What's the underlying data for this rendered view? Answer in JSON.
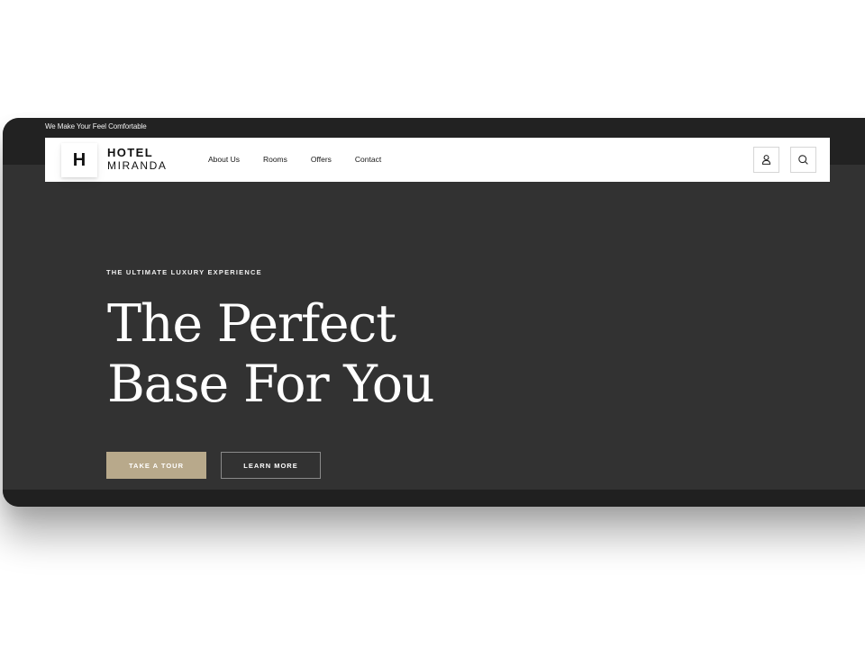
{
  "topbar": {
    "tagline": "We Make Your Feel Comfortable"
  },
  "header": {
    "logo_initial": "H",
    "brand_line1": "HOTEL",
    "brand_line2": "MIRANDA",
    "nav": [
      {
        "label": "About Us"
      },
      {
        "label": "Rooms"
      },
      {
        "label": "Offers"
      },
      {
        "label": "Contact"
      }
    ],
    "icons": {
      "account": "user-icon",
      "search": "search-icon"
    }
  },
  "hero": {
    "eyebrow": "THE ULTIMATE LUXURY EXPERIENCE",
    "headline_line1": "The Perfect",
    "headline_line2": "Base For You",
    "primary_button": "TAKE A TOUR",
    "secondary_button": "LEARN MORE"
  },
  "colors": {
    "dark_bg": "#222222",
    "hero_bg": "#323232",
    "accent": "#b8a98b",
    "text_light": "#ffffff"
  }
}
